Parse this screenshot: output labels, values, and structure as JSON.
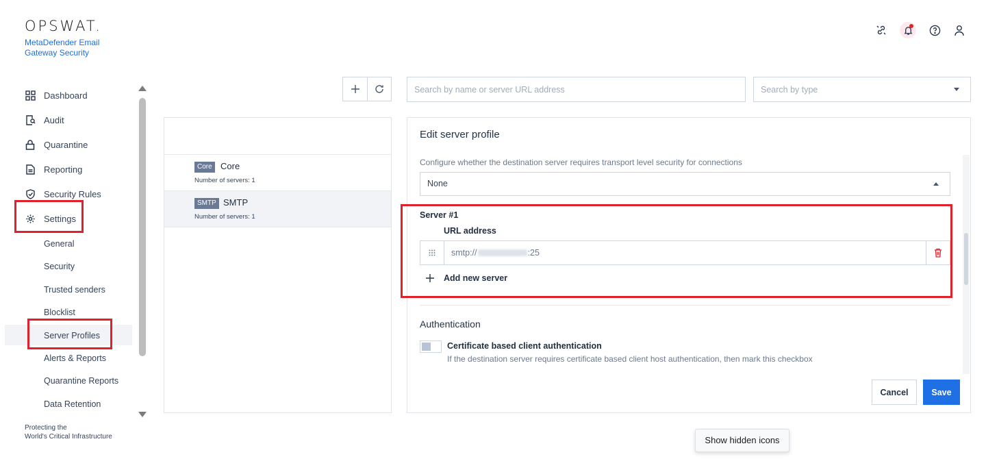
{
  "brand": {
    "logo": "OPSWAT.",
    "product": "MetaDefender Email Gateway Security"
  },
  "header_icons": [
    "unlink-icon",
    "bell-icon",
    "help-icon",
    "user-icon"
  ],
  "sidebar": {
    "items": [
      {
        "label": "Dashboard",
        "icon": "grid-icon"
      },
      {
        "label": "Audit",
        "icon": "audit-icon"
      },
      {
        "label": "Quarantine",
        "icon": "lock-icon"
      },
      {
        "label": "Reporting",
        "icon": "document-icon"
      },
      {
        "label": "Security Rules",
        "icon": "shield-check-icon"
      },
      {
        "label": "Settings",
        "icon": "gear-icon"
      }
    ],
    "sub_items": [
      "General",
      "Security",
      "Trusted senders",
      "Blocklist",
      "Server Profiles",
      "Alerts & Reports",
      "Quarantine Reports",
      "Data Retention"
    ],
    "footer_line1": "Protecting the",
    "footer_line2": "World's Critical Infrastructure"
  },
  "toolbar": {
    "search_placeholder": "Search by name or server URL address",
    "type_placeholder": "Search by type"
  },
  "profiles": [
    {
      "tag": "Core",
      "name": "Core",
      "count": "Number of servers: 1"
    },
    {
      "tag": "SMTP",
      "name": "SMTP",
      "count": "Number of servers: 1"
    }
  ],
  "edit": {
    "title": "Edit server profile",
    "tls_description": "Configure whether the destination server requires transport level security for connections",
    "tls_value": "None",
    "server_title": "Server #1",
    "url_label": "URL address",
    "url_prefix": "smtp://",
    "url_suffix": ":25",
    "add_server": "Add new server",
    "auth_title": "Authentication",
    "cert_title": "Certificate based client authentication",
    "cert_desc": "If the destination server requires certificate based client host authentication, then mark this checkbox",
    "cancel": "Cancel",
    "save": "Save"
  },
  "tooltip": "Show hidden icons",
  "colors": {
    "accent": "#1f6fe5",
    "highlight": "#e0202b",
    "tag": "#6a7a96"
  }
}
